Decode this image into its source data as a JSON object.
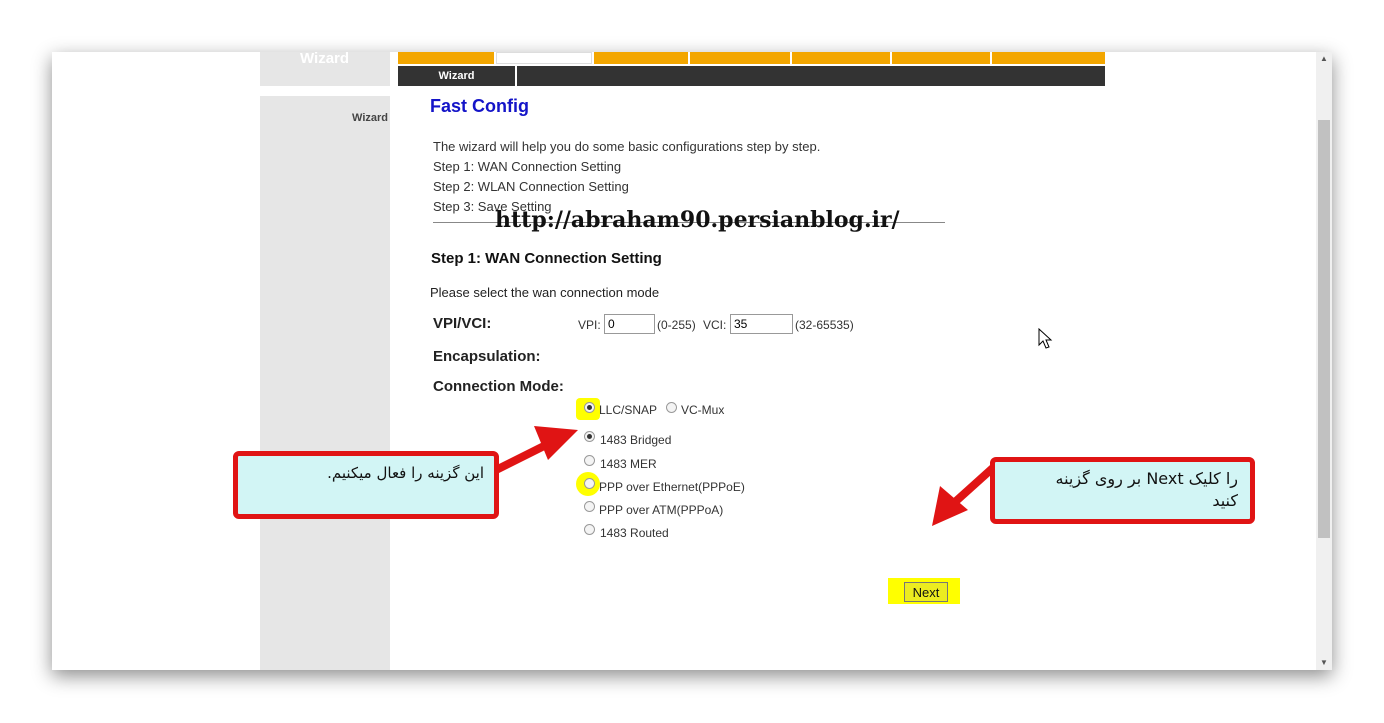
{
  "left_header": {
    "title": "Wizard"
  },
  "sidebar": {
    "item_label": "Wizard"
  },
  "subnav": {
    "wizard_tab": "Wizard"
  },
  "page": {
    "title": "Fast Config",
    "intro_lines": [
      "The wizard will help you do some basic configurations step by step.",
      "Step 1: WAN Connection Setting",
      "Step 2: WLAN Connection Setting",
      "Step 3: Save Setting"
    ],
    "watermark": "http://abraham90.persianblog.ir/",
    "step_heading": "Step 1: WAN Connection Setting",
    "select_prompt": "Please select the wan connection mode"
  },
  "form": {
    "vpivci_label": "VPI/VCI:",
    "vpi_label": "VPI:",
    "vpi_value": "0",
    "vpi_range": "(0-255)",
    "vci_label": "VCI:",
    "vci_value": "35",
    "vci_range": "(32-65535)",
    "encapsulation_label": "Encapsulation:",
    "encapsulation_options": [
      "LLC/SNAP",
      "VC-Mux"
    ],
    "encapsulation_selected": "LLC/SNAP",
    "connection_mode_label": "Connection Mode:",
    "connection_modes": [
      "1483 Bridged",
      "1483 MER",
      "PPP over Ethernet(PPPoE)",
      "PPP over ATM(PPPoA)",
      "1483 Routed"
    ],
    "connection_mode_selected": "1483 Bridged",
    "next_label": "Next"
  },
  "annotations": {
    "left_callout": "این گزینه را فعال میکنیم.",
    "right_callout_line1": "را کلیک  Next  بر روی گزینه",
    "right_callout_line2": "کنید"
  },
  "colors": {
    "tab_orange": "#f3a600",
    "subnav_dark": "#333333",
    "title_blue": "#1414c8",
    "highlight_yellow": "#ffff00",
    "callout_red": "#e01414",
    "callout_fill": "#d2f5f5"
  }
}
